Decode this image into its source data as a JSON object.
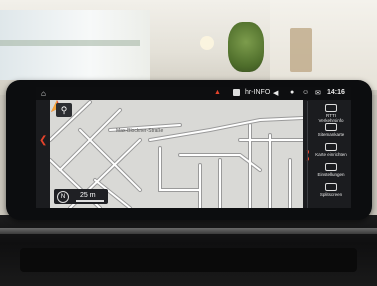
{
  "statusbar": {
    "home_icon": "home-icon",
    "station": "hr-INFO",
    "time": "14:16"
  },
  "map": {
    "search_icon": "search-icon",
    "street_label": "Max-Blockner-Straße",
    "scale": "25 m"
  },
  "menu": {
    "items": [
      {
        "icon": "rtti-icon",
        "label_top": "RTTI",
        "label": "Verkehrsinfo"
      },
      {
        "icon": "map-icon",
        "label": "Sitemankarte"
      },
      {
        "icon": "compass-icon",
        "label": "Karte einrichten"
      },
      {
        "icon": "gear-icon",
        "label": "Einstellungen"
      },
      {
        "icon": "split-icon",
        "label": "Splitscreen"
      }
    ]
  },
  "colors": {
    "accent": "#e3432b",
    "screen_bg": "#1b1c1f",
    "map_bg": "#d9d9d6"
  }
}
